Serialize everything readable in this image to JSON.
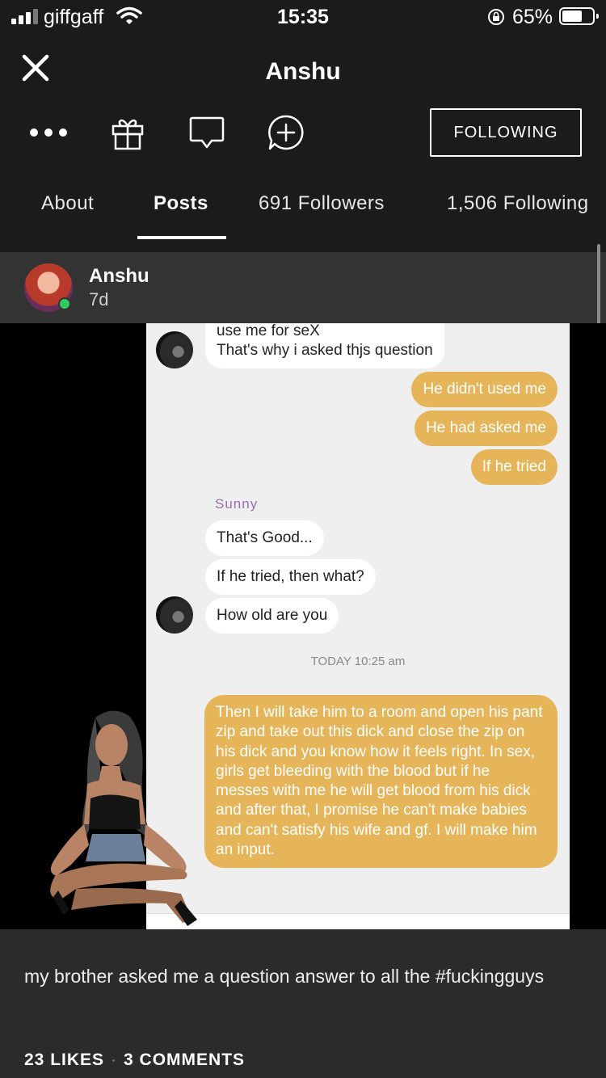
{
  "status_bar": {
    "carrier": "giffgaff",
    "time": "15:35",
    "battery": "65%"
  },
  "header": {
    "title": "Anshu",
    "follow_button": "FOLLOWING",
    "icons": [
      "more-icon",
      "gift-icon",
      "message-icon",
      "add-comment-icon"
    ]
  },
  "tabs": [
    {
      "label": "About"
    },
    {
      "label": "Posts"
    },
    {
      "label": "691 Followers"
    },
    {
      "label": "1,506 Following"
    }
  ],
  "post": {
    "author": "Anshu",
    "age": "7d",
    "online_color": "#2ecc5e",
    "image": {
      "messages": [
        {
          "line1": "use me for seX",
          "line2": "That's why i asked thjs question"
        },
        {
          "text": "He didn't used me"
        },
        {
          "text": "He had asked me"
        },
        {
          "text": "If he tried"
        },
        {
          "text": "That's Good..."
        },
        {
          "text": "If he tried, then what?"
        },
        {
          "text": "How old are you"
        },
        {
          "text": "Then I will take him to a room and open his pant zip and take out this dick and close the zip on his dick and you know how it feels right. In sex, girls get bleeding with the blood but if he messes with me he will get blood from his dick and after that, I promise he can't make babies and can't satisfy his wife and gf. I will make him an input."
        }
      ],
      "sender_name": "Sunny",
      "timestamp": "TODAY 10:25 am",
      "bubble_color": "#e6b55a"
    },
    "caption": "my brother asked me a question answer to all the #fuckingguys",
    "likes": "23 LIKES",
    "comments": "3 COMMENTS"
  }
}
